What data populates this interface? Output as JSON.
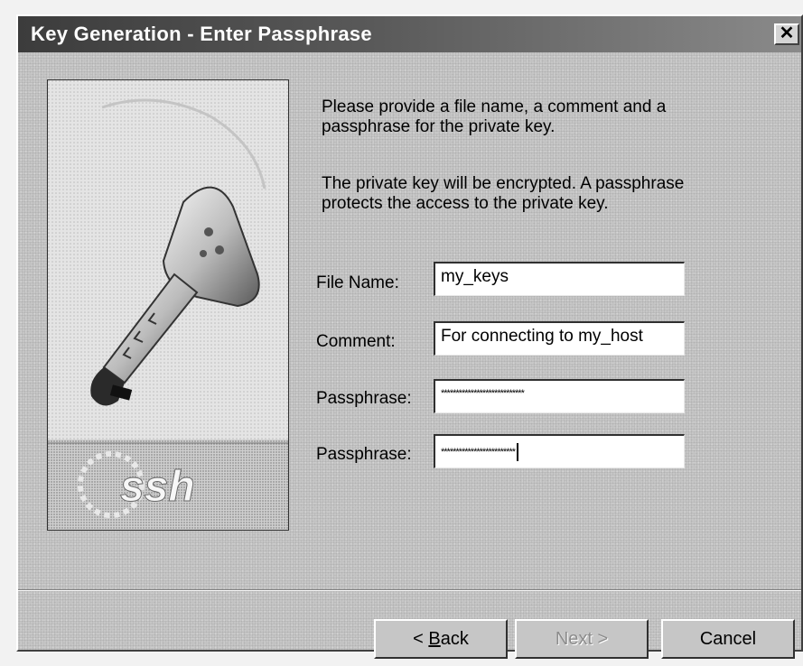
{
  "window": {
    "title": "Key Generation - Enter Passphrase",
    "close_label": "✕"
  },
  "image_panel": {
    "logo_text": "ssh",
    "icon": "key-icon"
  },
  "instructions": {
    "line1": "Please provide a file name, a comment and a passphrase for the private key.",
    "line2": "The private key will be encrypted. A passphrase protects the access to the private key."
  },
  "form": {
    "file_name_label": "File Name:",
    "file_name_value": "my_keys",
    "comment_label": "Comment:",
    "comment_value": "For connecting to my_host",
    "passphrase_label": "Passphrase:",
    "passphrase_value": "****************************",
    "passphrase_confirm_label": "Passphrase:",
    "passphrase_confirm_value": "*************************"
  },
  "buttons": {
    "back_prefix": "< ",
    "back_mnemonic": "B",
    "back_rest": "ack",
    "next_label": "Next >",
    "cancel_label": "Cancel"
  },
  "colors": {
    "titlebar": "#3c3c3c",
    "dialog_bg": "#c6c6c6",
    "input_bg": "#ffffff"
  }
}
